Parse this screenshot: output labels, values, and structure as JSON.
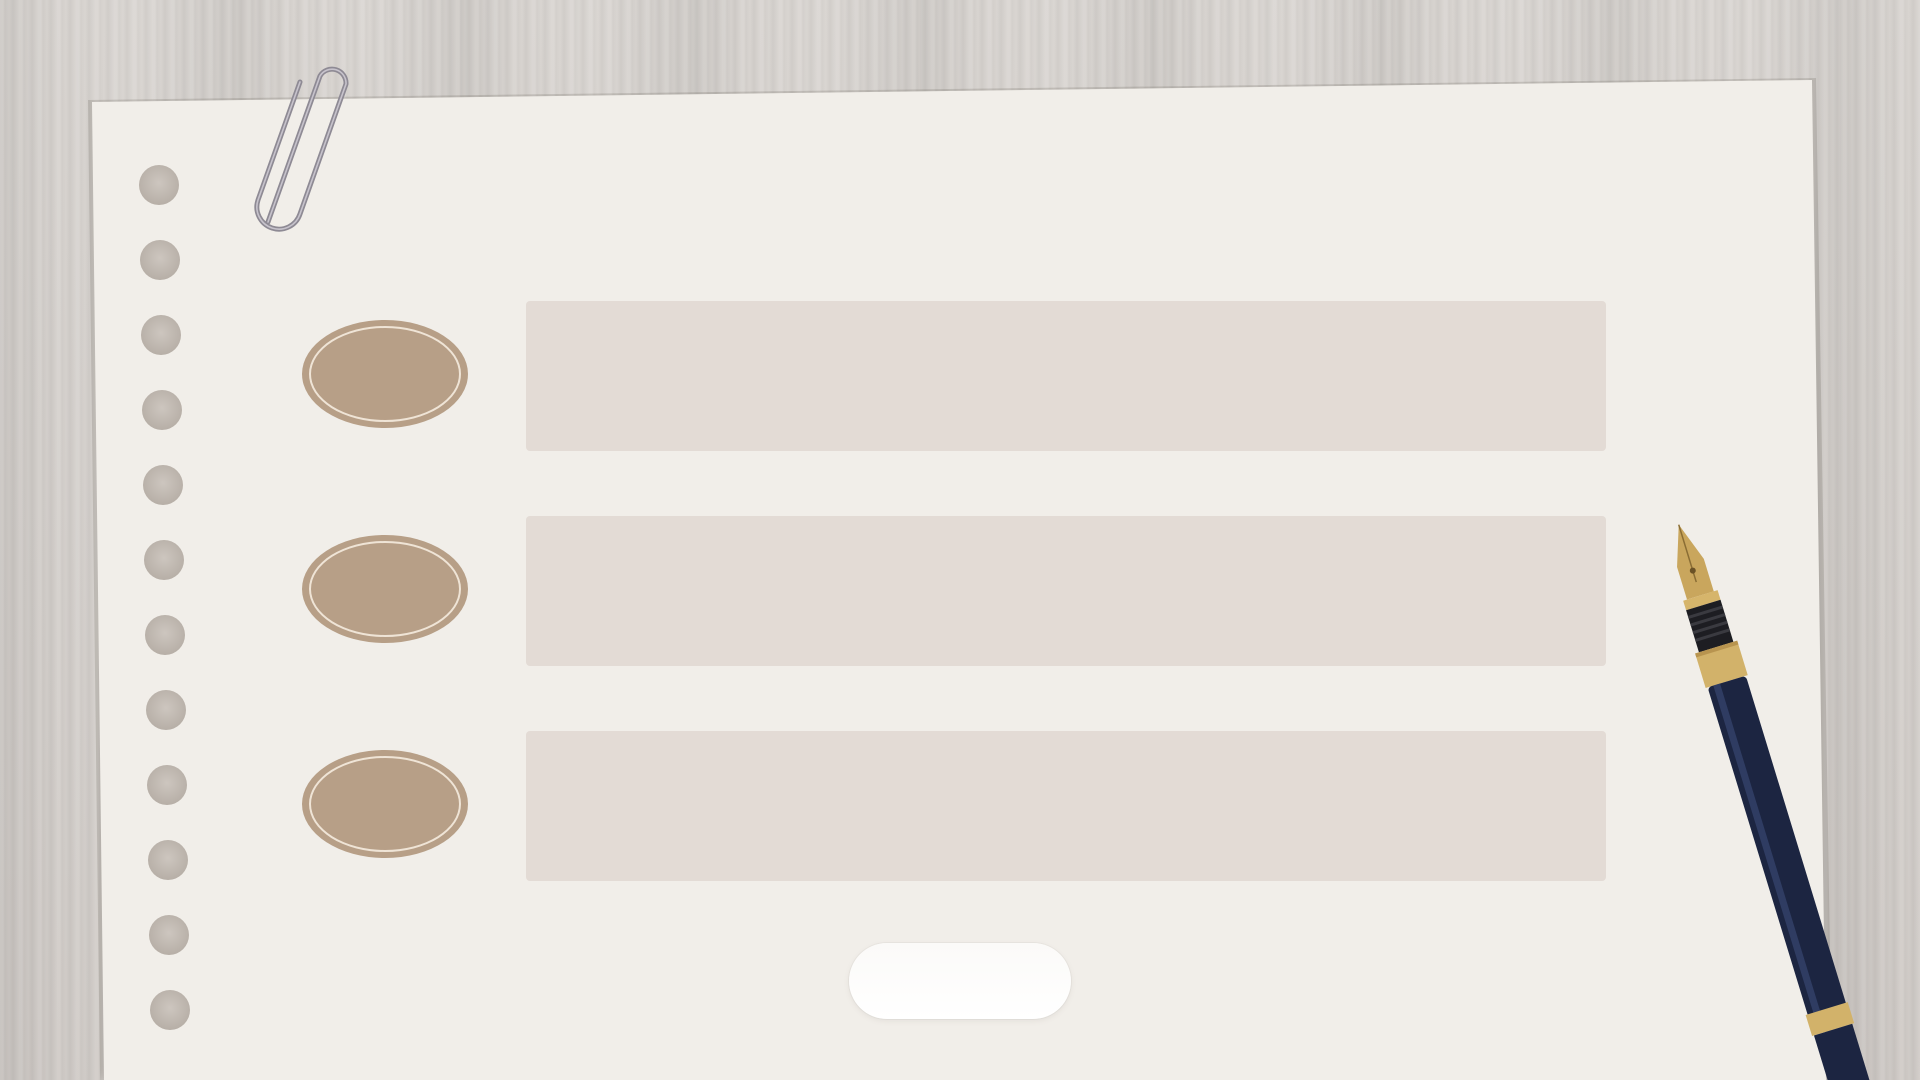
{
  "canvas": {
    "background": "#d3cfcb",
    "paper_color": "#f1eee9"
  },
  "rows": [
    {
      "badge_text": "",
      "bar_text": ""
    },
    {
      "badge_text": "",
      "bar_text": ""
    },
    {
      "badge_text": "",
      "bar_text": ""
    }
  ],
  "button": {
    "label": ""
  },
  "colors": {
    "badge": "#b79f87",
    "badge_ring": "#efe4d6",
    "bar": "#e3dbd5",
    "hole": "#b8b0a8",
    "pen_body": "#1c2541",
    "pen_trim": "#c9a65d"
  },
  "decorations": {
    "paperclip_icon": "paperclip-icon",
    "pen_icon": "fountain-pen-icon"
  }
}
